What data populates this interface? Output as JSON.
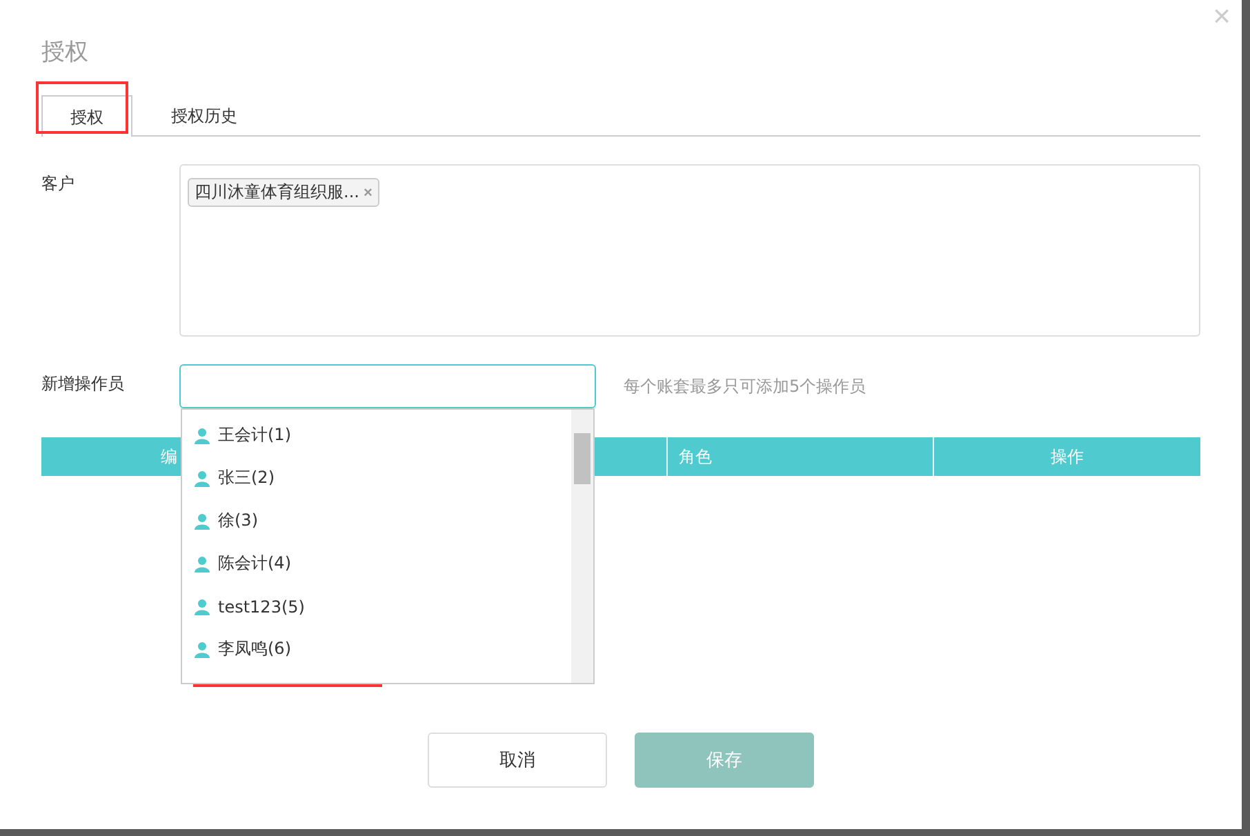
{
  "dialog": {
    "title": "授权",
    "close": "×"
  },
  "tabs": [
    {
      "label": "授权",
      "selected": true
    },
    {
      "label": "授权历史",
      "selected": false
    }
  ],
  "customer": {
    "label": "客户",
    "tags": [
      {
        "text": "四川沐童体育组织服...",
        "remove": "×"
      }
    ]
  },
  "operator": {
    "label": "新增操作员",
    "hint": "每个账套最多只可添加5个操作员"
  },
  "dropdown": {
    "options": [
      {
        "text": "王会计(1)"
      },
      {
        "text": "张三(2)"
      },
      {
        "text": "徐(3)"
      },
      {
        "text": "陈会计(4)"
      },
      {
        "text": "test123(5)"
      },
      {
        "text": "李凤鸣(6)"
      }
    ]
  },
  "table": {
    "columns": [
      "编",
      "角色",
      "操作"
    ]
  },
  "buttons": [
    {
      "label": "取消",
      "kind": "secondary",
      "disabled": false
    },
    {
      "label": "保存",
      "kind": "primary",
      "disabled": true
    }
  ]
}
